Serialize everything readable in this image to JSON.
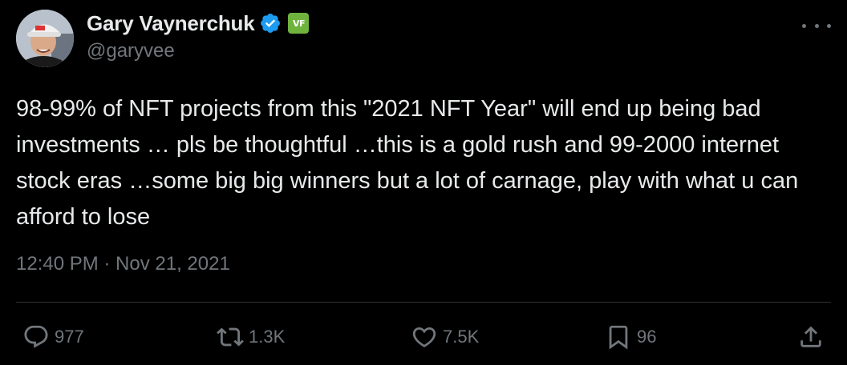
{
  "author": {
    "display_name": "Gary Vaynerchuk",
    "handle": "@garyvee",
    "affiliate_badge_text": "VF",
    "verified_color": "#1d9bf0"
  },
  "tweet": {
    "text": "98-99% of NFT projects from this \"2021 NFT Year\" will end up being bad investments … pls be thoughtful …this is a gold rush and 99-2000 internet stock eras …some big big winners but a lot of carnage, play with what u can afford to lose",
    "timestamp": "12:40 PM · Nov 21, 2021"
  },
  "actions": {
    "reply": {
      "icon": "reply-icon",
      "count": "977"
    },
    "retweet": {
      "icon": "retweet-icon",
      "count": "1.3K"
    },
    "like": {
      "icon": "heart-icon",
      "count": "7.5K"
    },
    "bookmark": {
      "icon": "bookmark-icon",
      "count": "96"
    },
    "share": {
      "icon": "share-icon"
    }
  },
  "colors": {
    "background": "#000000",
    "text": "#e7e9ea",
    "muted": "#71767b",
    "divider": "#2f3336",
    "affiliate_badge": "#6fb33e"
  }
}
